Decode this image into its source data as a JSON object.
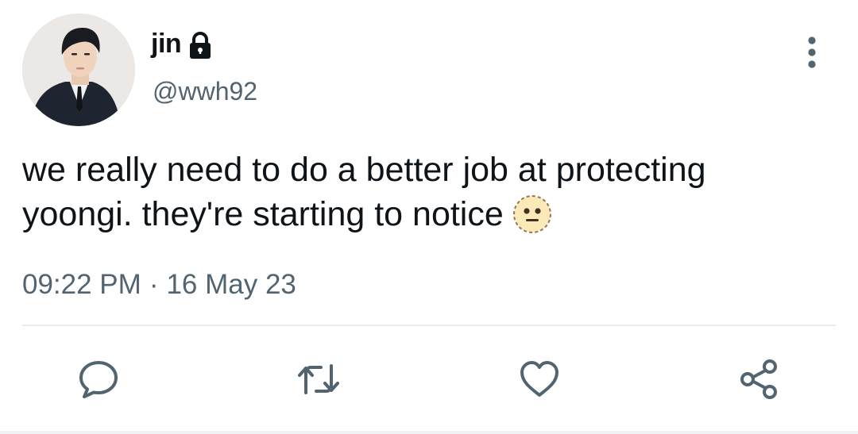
{
  "tweet": {
    "display_name": "jin",
    "handle": "@wwh92",
    "text": "we really need to do a better job at protecting yoongi. they're starting to notice",
    "emoji": "dotted-line-face",
    "time": "09:22 PM",
    "separator": "·",
    "date": "16 May 23",
    "protected": true
  },
  "actions": [
    {
      "name": "reply",
      "icon": "speech-bubble-icon"
    },
    {
      "name": "retweet",
      "icon": "retweet-icon"
    },
    {
      "name": "like",
      "icon": "heart-icon"
    },
    {
      "name": "share",
      "icon": "share-icon"
    }
  ],
  "colors": {
    "text": "#0f1419",
    "secondary": "#536471",
    "divider": "#e6ecf0",
    "emoji_face": "#fbe9b8"
  }
}
